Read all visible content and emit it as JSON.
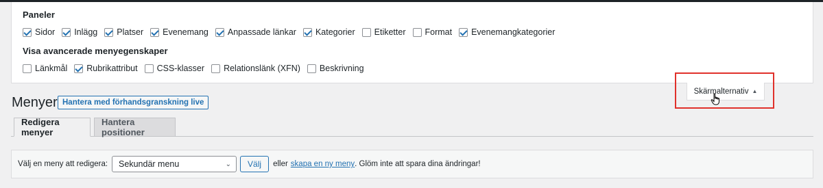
{
  "screen_options": {
    "panels_title": "Paneler",
    "panels": [
      {
        "label": "Sidor",
        "checked": true
      },
      {
        "label": "Inlägg",
        "checked": true
      },
      {
        "label": "Platser",
        "checked": true
      },
      {
        "label": "Evenemang",
        "checked": true
      },
      {
        "label": "Anpassade länkar",
        "checked": true
      },
      {
        "label": "Kategorier",
        "checked": true
      },
      {
        "label": "Etiketter",
        "checked": false
      },
      {
        "label": "Format",
        "checked": false
      },
      {
        "label": "Evenemangkategorier",
        "checked": true
      }
    ],
    "advanced_title": "Visa avancerade menyegenskaper",
    "advanced": [
      {
        "label": "Länkmål",
        "checked": false
      },
      {
        "label": "Rubrikattribut",
        "checked": true
      },
      {
        "label": "CSS-klasser",
        "checked": false
      },
      {
        "label": "Relationslänk (XFN)",
        "checked": false
      },
      {
        "label": "Beskrivning",
        "checked": false
      }
    ],
    "toggle_label": "Skärmalternativ"
  },
  "header": {
    "title": "Menyer",
    "live_button": "Hantera med förhandsgranskning live"
  },
  "tabs": {
    "edit": "Redigera menyer",
    "locations": "Hantera positioner"
  },
  "manage": {
    "label": "Välj en meny att redigera:",
    "selected_menu": "Sekundär menu",
    "choose_button": "Välj",
    "or_text": "eller",
    "create_link": "skapa en ny meny",
    "reminder": ". Glöm inte att spara dina ändringar!"
  }
}
